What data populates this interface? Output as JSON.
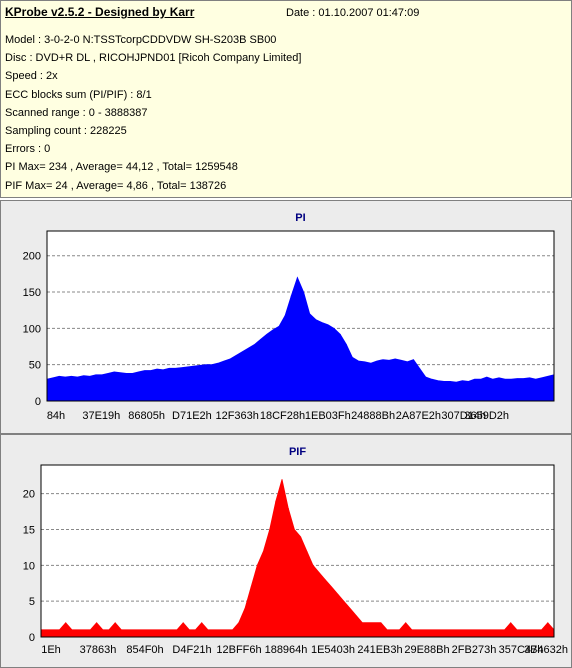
{
  "header": {
    "title": "KProbe v2.5.2 - Designed by Karr",
    "date": "Date : 01.10.2007 01:47:09",
    "lines": [
      "Model : 3-0-2-0 N:TSSTcorpCDDVDW SH-S203B  SB00",
      "Disc : DVD+R DL , RICOHJPND01 [Ricoh Company Limited]",
      "Speed : 2x",
      "ECC blocks sum (PI/PIF) : 8/1",
      "Scanned range : 0 - 3888387",
      "Sampling count : 228225",
      "Errors : 0",
      "PI Max= 234 , Average= 44,12 , Total= 1259548",
      "PIF Max= 24 , Average= 4,86 , Total= 138726"
    ]
  },
  "colors": {
    "pi": "#0000ff",
    "pif": "#ff0000",
    "title": "#000080",
    "panel_bg": "#ececec",
    "plot_bg": "#ffffff"
  },
  "chart_data": [
    {
      "type": "area",
      "title": "PI",
      "xlabel": "",
      "ylabel": "",
      "ylim": [
        0,
        234
      ],
      "y_ticks": [
        0,
        50,
        100,
        150,
        200
      ],
      "x_tick_labels": [
        "84h",
        "37E19h",
        "86805h",
        "D71E2h",
        "12F363h",
        "18CF28h",
        "1EB03Fh",
        "24888Bh",
        "2A87E2h",
        "307D14h",
        "3659D2h"
      ],
      "grid": "horizontal dashed",
      "series": [
        {
          "values": [
            30,
            32,
            34,
            33,
            34,
            33,
            35,
            34,
            36,
            36,
            38,
            40,
            39,
            38,
            38,
            40,
            42,
            42,
            44,
            43,
            45,
            45,
            46,
            47,
            48,
            49,
            50,
            50,
            52,
            55,
            58,
            63,
            68,
            73,
            78,
            85,
            92,
            98,
            103,
            118,
            145,
            170,
            150,
            120,
            112,
            108,
            105,
            100,
            92,
            78,
            60,
            55,
            54,
            52,
            55,
            57,
            56,
            58,
            56,
            54,
            57,
            45,
            33,
            30,
            28,
            27,
            27,
            26,
            28,
            27,
            30,
            30,
            33,
            30,
            32,
            30,
            30,
            31,
            31,
            32,
            30,
            32,
            34,
            36
          ]
        }
      ]
    },
    {
      "type": "area",
      "title": "PIF",
      "xlabel": "",
      "ylabel": "",
      "ylim": [
        0,
        24
      ],
      "y_ticks": [
        0,
        5,
        10,
        15,
        20
      ],
      "x_tick_labels": [
        "1Eh",
        "37863h",
        "854F0h",
        "D4F21h",
        "12BFF6h",
        "188964h",
        "1E5403h",
        "241EB3h",
        "29E88Bh",
        "2FB273h",
        "357C47h",
        "3B4632h"
      ],
      "grid": "horizontal dashed",
      "series": [
        {
          "values": [
            1,
            1,
            1,
            1,
            2,
            1,
            1,
            1,
            1,
            2,
            1,
            1,
            2,
            1,
            1,
            1,
            1,
            1,
            1,
            1,
            1,
            1,
            1,
            2,
            1,
            1,
            2,
            1,
            1,
            1,
            1,
            1,
            2,
            4,
            7,
            10,
            12,
            15,
            19,
            22,
            18,
            15,
            14,
            12,
            10,
            9,
            8,
            7,
            6,
            5,
            4,
            3,
            2,
            2,
            2,
            2,
            1,
            1,
            1,
            2,
            1,
            1,
            1,
            1,
            1,
            1,
            1,
            1,
            1,
            1,
            1,
            1,
            1,
            1,
            1,
            1,
            2,
            1,
            1,
            1,
            1,
            1,
            2,
            1
          ]
        }
      ]
    }
  ]
}
